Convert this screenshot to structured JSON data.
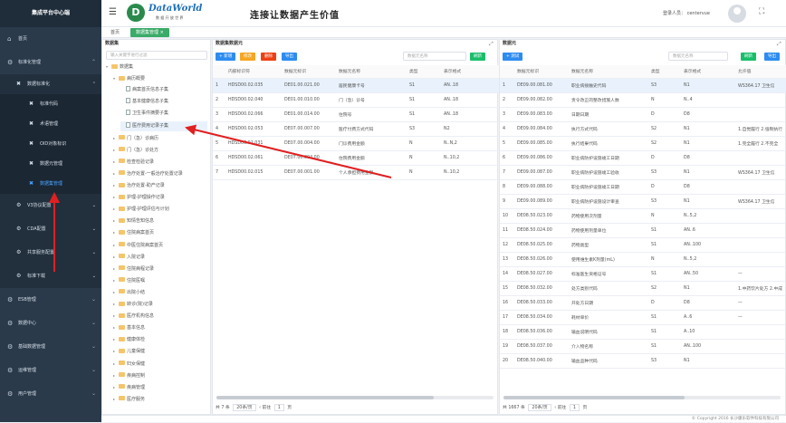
{
  "app": {
    "title": "集成平台中心端"
  },
  "sidebar": {
    "items": [
      {
        "label": "首页",
        "icon": "home-icon",
        "glyph": "⌂"
      },
      {
        "label": "标准化管理",
        "icon": "gear-icon",
        "glyph": "⚙",
        "expanded": true
      }
    ],
    "sub": {
      "label": "数据标准化",
      "glyph": "✖"
    },
    "children": [
      {
        "label": "标准代码"
      },
      {
        "label": "术语管理"
      },
      {
        "label": "OID对象标识"
      },
      {
        "label": "数据元管理"
      },
      {
        "label": "数据集管理",
        "active": true
      }
    ],
    "more": [
      {
        "label": "V3协议配置"
      },
      {
        "label": "CDA配置"
      },
      {
        "label": "共享服务配置"
      },
      {
        "label": "标准下载"
      }
    ],
    "bottom": [
      {
        "label": "ESB管理"
      },
      {
        "label": "数据中心"
      },
      {
        "label": "基础数据管理"
      },
      {
        "label": "运维管理"
      },
      {
        "label": "用户管理"
      }
    ]
  },
  "header": {
    "brand_name": "DataWorld",
    "brand_sub": "数 据 开 放 世 界",
    "slogan": "连接让数据产生价值",
    "login_label": "登录人员：",
    "login_user": "centervue"
  },
  "tabs": {
    "home": "首页",
    "active": "数据集管理 ×"
  },
  "dataset_panel": {
    "title": "数据集",
    "search_placeholder": "输入关键字进行过滤",
    "tree": [
      {
        "label": "数据集",
        "depth": 0,
        "kind": "folder",
        "open": true
      },
      {
        "label": "病历概要",
        "depth": 1,
        "kind": "folder",
        "open": true
      },
      {
        "label": "病案首页信息子集",
        "depth": 2,
        "kind": "file"
      },
      {
        "label": "基本健康信息子集",
        "depth": 2,
        "kind": "file"
      },
      {
        "label": "卫生事件摘要子集",
        "depth": 2,
        "kind": "file"
      },
      {
        "label": "医疗费用记录子集",
        "depth": 2,
        "kind": "file",
        "highlight": true
      },
      {
        "label": "门（急）诊病历",
        "depth": 1,
        "kind": "folder"
      },
      {
        "label": "门（急）诊处方",
        "depth": 1,
        "kind": "folder"
      },
      {
        "label": "检查检验记录",
        "depth": 1,
        "kind": "folder"
      },
      {
        "label": "治疗处置-一般治疗处置记录",
        "depth": 1,
        "kind": "folder"
      },
      {
        "label": "治疗处置-助产记录",
        "depth": 1,
        "kind": "folder"
      },
      {
        "label": "护理-护理操作记录",
        "depth": 1,
        "kind": "folder"
      },
      {
        "label": "护理-护理评估与计划",
        "depth": 1,
        "kind": "folder"
      },
      {
        "label": "知情告知信息",
        "depth": 1,
        "kind": "folder"
      },
      {
        "label": "住院病案首页",
        "depth": 1,
        "kind": "folder"
      },
      {
        "label": "中医住院病案首页",
        "depth": 1,
        "kind": "folder"
      },
      {
        "label": "入院记录",
        "depth": 1,
        "kind": "folder"
      },
      {
        "label": "住院病程记录",
        "depth": 1,
        "kind": "folder"
      },
      {
        "label": "住院医嘱",
        "depth": 1,
        "kind": "folder"
      },
      {
        "label": "出院小结",
        "depth": 1,
        "kind": "folder"
      },
      {
        "label": "转诊(院)记录",
        "depth": 1,
        "kind": "folder"
      },
      {
        "label": "医疗机构信息",
        "depth": 1,
        "kind": "folder"
      },
      {
        "label": "基本信息",
        "depth": 1,
        "kind": "folder"
      },
      {
        "label": "健康体检",
        "depth": 1,
        "kind": "folder"
      },
      {
        "label": "儿童保健",
        "depth": 1,
        "kind": "folder"
      },
      {
        "label": "妇女保健",
        "depth": 1,
        "kind": "folder"
      },
      {
        "label": "疾病控制",
        "depth": 1,
        "kind": "folder"
      },
      {
        "label": "疾病管理",
        "depth": 1,
        "kind": "folder"
      },
      {
        "label": "医疗服务",
        "depth": 1,
        "kind": "folder"
      }
    ]
  },
  "dataset_elements": {
    "title": "数据集数据元",
    "buttons": {
      "add": "+ 新增",
      "edit": "修改",
      "delete": "删除",
      "export": "导出",
      "refresh": "刷新"
    },
    "search_placeholder": "数据元名称",
    "columns": [
      "",
      "内部标识符",
      "数据元标识",
      "数据元名称",
      "类型",
      "表示格式"
    ],
    "rows": [
      [
        "1",
        "HDSD00.02.035",
        "DE01.00.021.00",
        "居民健康卡号",
        "S1",
        "AN..18"
      ],
      [
        "2",
        "HDSD00.02.040",
        "DE01.00.010.00",
        "门（急）诊号",
        "S1",
        "AN..18"
      ],
      [
        "3",
        "HDSD00.02.066",
        "DE01.00.014.00",
        "住院号",
        "S1",
        "AN..18"
      ],
      [
        "4",
        "HDSD00.02.053",
        "DE07.00.007.00",
        "医疗付费方式代码",
        "S3",
        "N2"
      ],
      [
        "5",
        "HDSD00.02.031",
        "DE07.00.004.00",
        "门诊费用金额",
        "N",
        "N..N,2"
      ],
      [
        "6",
        "HDSD00.02.061",
        "DE07.00.004.00",
        "住院费用金额",
        "N",
        "N..10,2"
      ],
      [
        "7",
        "HDSD00.02.015",
        "DE07.00.001.00",
        "个人承担费用金额",
        "N",
        "N..10,2"
      ]
    ],
    "footer": {
      "total": "共 7 条",
      "page_size": "20条/页",
      "goto": "前往",
      "page": "1",
      "page_unit": "页"
    }
  },
  "data_elements": {
    "title": "数据元",
    "buttons": {
      "test": "+ 测试",
      "refresh": "刷新",
      "export": "导出"
    },
    "search_placeholder": "数据元名称",
    "columns": [
      "",
      "数据元标识",
      "数据元名称",
      "类型",
      "表示格式",
      "允许值"
    ],
    "rows": [
      [
        "1",
        "DE09.00.081.00",
        "职业病接触史代码",
        "S3",
        "N1",
        "WS364.17 卫生信"
      ],
      [
        "2",
        "DE09.00.082.00",
        "责令改正的整改措施人数",
        "N",
        "N..4",
        ""
      ],
      [
        "3",
        "DE09.00.083.00",
        "日期日期",
        "D",
        "D8",
        ""
      ],
      [
        "4",
        "DE09.00.084.00",
        "执行方式代码",
        "S2",
        "N1",
        "1.自觉履行 2.强制执行"
      ],
      [
        "5",
        "DE09.00.085.00",
        "执行结果代码",
        "S2",
        "N1",
        "1.完全履行 2.不完全"
      ],
      [
        "6",
        "DE09.00.086.00",
        "职业病防护设施竣工日期",
        "D",
        "D8",
        ""
      ],
      [
        "7",
        "DE09.00.087.00",
        "职业病防护设施竣工验收",
        "S3",
        "N1",
        "WS364.17 卫生信"
      ],
      [
        "8",
        "DE09.00.088.00",
        "职业病防护设施竣工日期",
        "D",
        "D8",
        ""
      ],
      [
        "9",
        "DE09.00.089.00",
        "职业病防护设施设计审查",
        "S3",
        "N1",
        "WS364.17 卫生信"
      ],
      [
        "10",
        "DE08.50.023.00",
        "药物使用次剂量",
        "N",
        "N..5,2",
        ""
      ],
      [
        "11",
        "DE08.50.024.00",
        "药物使用剂量单位",
        "S1",
        "AN..6",
        ""
      ],
      [
        "12",
        "DE08.50.025.00",
        "药物类型",
        "S1",
        "AN..100",
        ""
      ],
      [
        "13",
        "DE08.50.026.00",
        "使用维生素K剂量(mL)",
        "N",
        "N..5,2",
        ""
      ],
      [
        "14",
        "DE08.50.027.00",
        "标准医生资格证号",
        "S1",
        "AN..50",
        "—"
      ],
      [
        "15",
        "DE08.50.032.00",
        "处方类别代码",
        "S2",
        "N1",
        "1.中药饮片处方 2.中成"
      ],
      [
        "16",
        "DE08.50.033.00",
        "开处方日期",
        "D",
        "D8",
        "—"
      ],
      [
        "17",
        "DE08.50.034.00",
        "耗材单价",
        "S1",
        "A..6",
        "—"
      ],
      [
        "18",
        "DE08.50.036.00",
        "输血说明代码",
        "S1",
        "A..10",
        ""
      ],
      [
        "19",
        "DE08.50.037.00",
        "介入物名称",
        "S1",
        "AN..100",
        ""
      ],
      [
        "20",
        "DE08.50.040.00",
        "输血品种代码",
        "S3",
        "N1",
        ""
      ]
    ],
    "footer": {
      "total": "共 1667 条",
      "page_size": "20条/页",
      "goto": "前往",
      "page": "1",
      "page_unit": "页"
    }
  },
  "footer": {
    "copyright": "© Copyright 2016 长沙康乐软件科技有限公司"
  },
  "colors": {
    "sidebar": "#2a3a4b",
    "accent": "#2d8cf0",
    "tab_active": "#3aab68"
  }
}
